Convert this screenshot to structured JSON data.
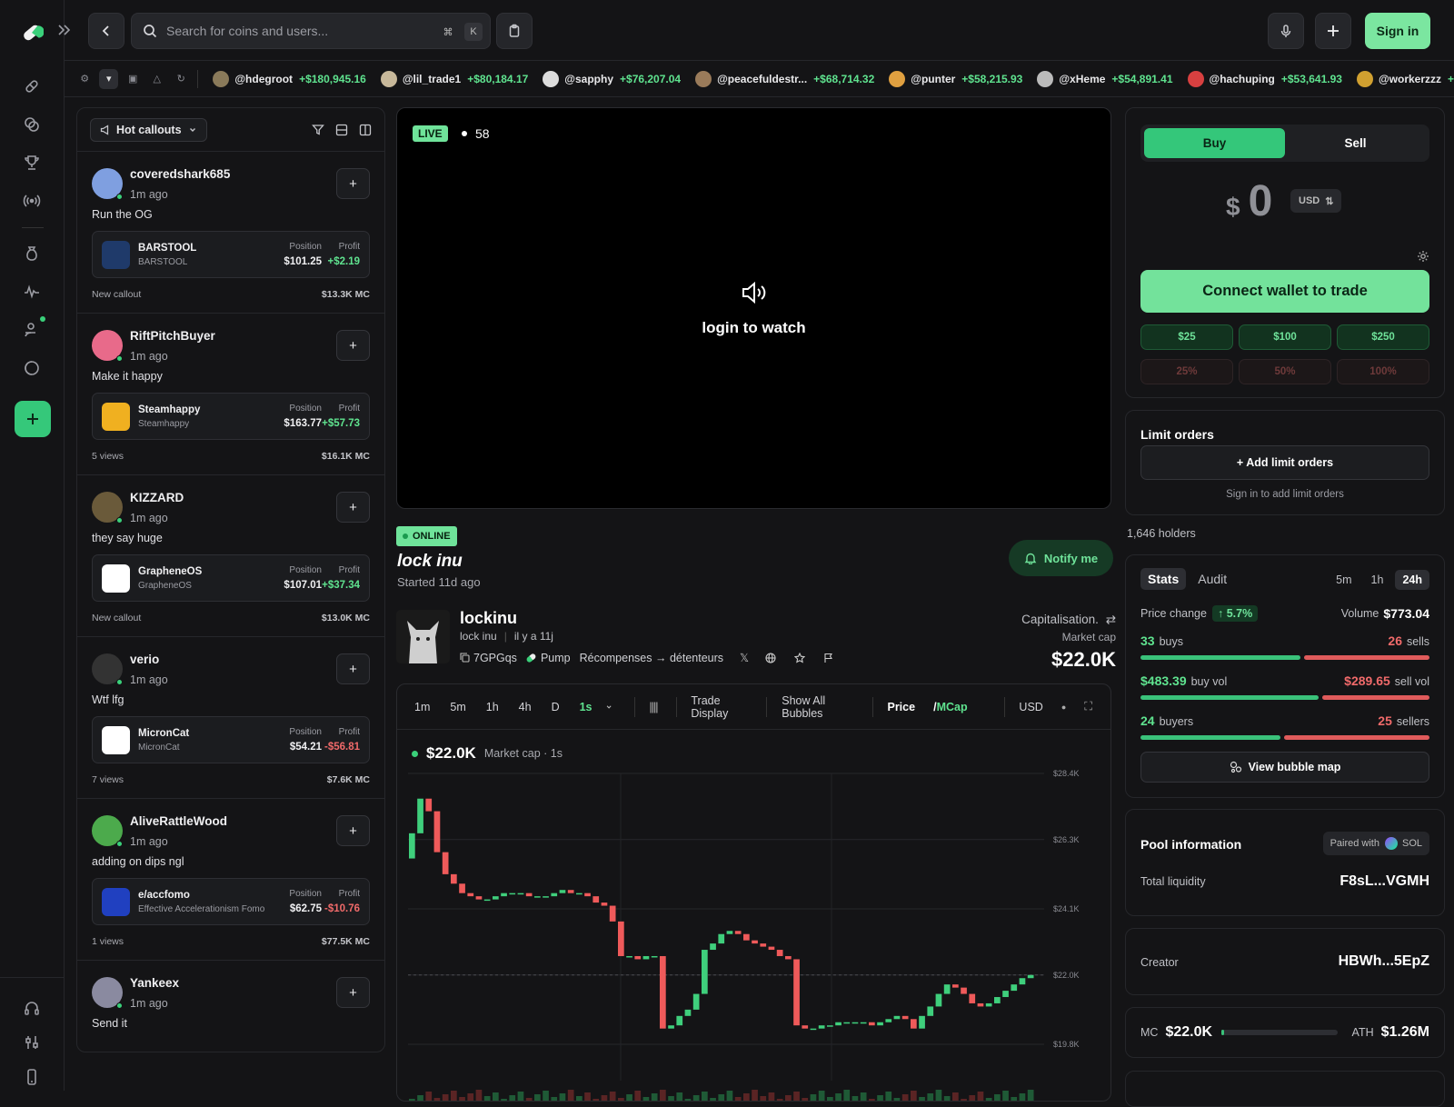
{
  "topbar": {
    "search_placeholder": "Search for coins and users...",
    "kbd_cmd": "⌘",
    "kbd_k": "K",
    "signin_label": "Sign in"
  },
  "ticker": [
    {
      "user": "@hdegroot",
      "amount": "+$180,945.16",
      "color": "#8a7a5a"
    },
    {
      "user": "@lil_trade1",
      "amount": "+$80,184.17",
      "color": "#c7b89a"
    },
    {
      "user": "@sapphy",
      "amount": "+$76,207.04",
      "color": "#dddddd"
    },
    {
      "user": "@peacefuldestr...",
      "amount": "+$68,714.32",
      "color": "#9a7b5a"
    },
    {
      "user": "@punter",
      "amount": "+$58,215.93",
      "color": "#e0a040"
    },
    {
      "user": "@xHeme",
      "amount": "+$54,891.41",
      "color": "#bbbbbb"
    },
    {
      "user": "@hachuping",
      "amount": "+$53,641.93",
      "color": "#d84040"
    },
    {
      "user": "@workerzzz",
      "amount": "+",
      "color": "#d0a030"
    }
  ],
  "callouts": {
    "filter_label": "Hot callouts",
    "position_label": "Position",
    "profit_label": "Profit",
    "items": [
      {
        "user": "coveredshark685",
        "time": "1m ago",
        "text": "Run the OG",
        "token": "BARSTOOL",
        "token_sub": "BARSTOOL",
        "position": "$101.25",
        "profit": "+$2.19",
        "profit_positive": true,
        "meta": "New callout",
        "mc": "$13.3K MC",
        "avatar_color": "#7f9fe0",
        "icon_color": "#1f3a6a"
      },
      {
        "user": "RiftPitchBuyer",
        "time": "1m ago",
        "text": "Make it happy",
        "token": "Steamhappy",
        "token_sub": "Steamhappy",
        "position": "$163.77",
        "profit": "+$57.73",
        "profit_positive": true,
        "meta": "5 views",
        "mc": "$16.1K MC",
        "avatar_color": "#e86a8a",
        "icon_color": "#f0b020"
      },
      {
        "user": "KIZZARD",
        "time": "1m ago",
        "text": "they say huge",
        "token": "GrapheneOS",
        "token_sub": "GrapheneOS",
        "position": "$107.01",
        "profit": "+$37.34",
        "profit_positive": true,
        "meta": "New callout",
        "mc": "$13.0K MC",
        "avatar_color": "#6a5a3a",
        "icon_color": "#ffffff"
      },
      {
        "user": "verio",
        "time": "1m ago",
        "text": "Wtf lfg",
        "token": "MicronCat",
        "token_sub": "MicronCat",
        "position": "$54.21",
        "profit": "-$56.81",
        "profit_positive": false,
        "meta": "7 views",
        "mc": "$7.6K MC",
        "avatar_color": "#333333",
        "icon_color": "#ffffff"
      },
      {
        "user": "AliveRattleWood",
        "time": "1m ago",
        "text": "adding on dips ngl",
        "token": "e/accfomo",
        "token_sub": "Effective Accelerationism Fomo",
        "position": "$62.75",
        "profit": "-$10.76",
        "profit_positive": false,
        "meta": "1 views",
        "mc": "$77.5K MC",
        "avatar_color": "#4caa4c",
        "icon_color": "#2040c0"
      },
      {
        "user": "Yankeex",
        "time": "1m ago",
        "text": "Send it",
        "token": "",
        "token_sub": "",
        "position": "",
        "profit": "",
        "profit_positive": true,
        "meta": "",
        "mc": "",
        "avatar_color": "#8a8aa0",
        "icon_color": "#333333"
      }
    ]
  },
  "stream": {
    "live_label": "LIVE",
    "viewers": "58",
    "login_text": "login to watch",
    "status": "ONLINE",
    "title": "lock inu",
    "started": "Started 11d ago",
    "notify_label": "Notify me"
  },
  "token": {
    "symbol": "lockinu",
    "name": "lock inu",
    "age": "il y a 11j",
    "address": "7GPGqs",
    "platform": "Pump",
    "rewards": "Récompenses → détenteurs",
    "cap_label": "Capitalisation.",
    "market_cap_label": "Market cap",
    "market_cap": "$22.0K"
  },
  "chart_tools": {
    "intervals": [
      "1m",
      "5m",
      "1h",
      "4h",
      "D",
      "1s"
    ],
    "trade_display": "Trade Display",
    "show_bubbles": "Show All Bubbles",
    "price_label": "Price",
    "mcap_label": "MCap",
    "currency": "USD",
    "current_value": "$22.0K",
    "value_caption": "Market cap · 1s"
  },
  "chart_data": {
    "type": "candlestick",
    "y_ticks": [
      "$28.4K",
      "$26.3K",
      "$24.1K",
      "$22.0K",
      "$19.8K"
    ],
    "ylim": [
      19.8,
      28.4
    ],
    "current": 22.0,
    "candles_close": [
      26.5,
      27.6,
      27.2,
      25.9,
      25.2,
      24.9,
      24.6,
      24.5,
      24.4,
      24.4,
      24.5,
      24.6,
      24.6,
      24.6,
      24.5,
      24.5,
      24.5,
      24.6,
      24.7,
      24.6,
      24.6,
      24.5,
      24.3,
      24.2,
      23.7,
      22.6,
      22.6,
      22.5,
      22.6,
      22.6,
      20.3,
      20.4,
      20.7,
      20.9,
      21.4,
      22.8,
      23.0,
      23.3,
      23.4,
      23.3,
      23.1,
      23.0,
      22.9,
      22.8,
      22.6,
      22.5,
      20.4,
      20.3,
      20.3,
      20.4,
      20.4,
      20.5,
      20.5,
      20.5,
      20.5,
      20.4,
      20.5,
      20.6,
      20.7,
      20.6,
      20.3,
      20.7,
      21.0,
      21.4,
      21.7,
      21.6,
      21.4,
      21.1,
      21.0,
      21.1,
      21.3,
      21.5,
      21.7,
      21.9,
      22.0
    ],
    "mcap": "$22.0K"
  },
  "trade": {
    "buy_label": "Buy",
    "sell_label": "Sell",
    "currency_symbol": "$",
    "amount": "0",
    "currency": "USD",
    "connect_label": "Connect wallet to trade",
    "quick_buy": [
      "$25",
      "$100",
      "$250"
    ],
    "quick_sell": [
      "25%",
      "50%",
      "100%"
    ]
  },
  "limit": {
    "title": "Limit orders",
    "add_label": "+ Add limit orders",
    "hint": "Sign in to add limit orders"
  },
  "holders": "1,646 holders",
  "stats": {
    "tabs": [
      "Stats",
      "Audit"
    ],
    "timeframes": [
      "5m",
      "1h",
      "24h"
    ],
    "price_change_label": "Price change",
    "price_change": "↑ 5.7%",
    "volume_label": "Volume",
    "volume": "$773.04",
    "buys": "33",
    "buys_label": "buys",
    "sells": "26",
    "sells_label": "sells",
    "buy_vol": "$483.39",
    "buy_vol_label": "buy vol",
    "sell_vol": "$289.65",
    "sell_vol_label": "sell vol",
    "buyers": "24",
    "buyers_label": "buyers",
    "sellers": "25",
    "sellers_label": "sellers",
    "bubble_label": "View bubble map"
  },
  "pool": {
    "title": "Pool information",
    "paired_label": "Paired with",
    "paired_token": "SOL",
    "liquidity_label": "Total liquidity",
    "liquidity_value": "F8sL...VGMH"
  },
  "creator": {
    "label": "Creator",
    "value": "HBWh...5EpZ"
  },
  "mc_row": {
    "mc_label": "MC",
    "mc": "$22.0K",
    "ath_label": "ATH",
    "ath": "$1.26M",
    "progress": 0.02
  },
  "colors": {
    "accent": "#35c87a",
    "buy_green": "#5fe38f",
    "sell_red": "#f06a6a",
    "bg": "#141416"
  }
}
